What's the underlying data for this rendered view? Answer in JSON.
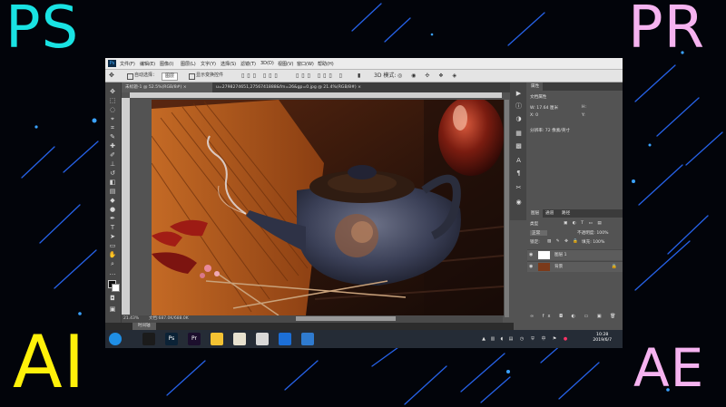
{
  "corner_labels": {
    "ps": "PS",
    "pr": "PR",
    "ai": "AI",
    "ae": "AE"
  },
  "colors": {
    "ps": "#19e3e3",
    "pr": "#f6b3f0",
    "ai": "#fff10a",
    "ae": "#f6b3f0",
    "background": "#02040a",
    "photoshop_ui": "#535353"
  },
  "photoshop": {
    "app_icon": "Ps",
    "menu": [
      "文件(F)",
      "编辑(E)",
      "图像(I)",
      "图层(L)",
      "文字(Y)",
      "选择(S)",
      "滤镜(T)",
      "3D(D)",
      "视图(V)",
      "窗口(W)",
      "帮助(H)"
    ],
    "options_bar": {
      "auto_select": "自动选择：",
      "auto_select_value": "图层",
      "show_transform": "显示变换控件"
    },
    "document_tabs": [
      {
        "label": "未标题-1 @ 52.5%(RGB/8#) ×",
        "active": true
      },
      {
        "label": "u=2798274651,2756741888&fm=26&gp=0.jpg @ 21.4%(RGB/8#) ×",
        "active": false
      }
    ],
    "status": {
      "zoom": "21.43%",
      "doc_size": "文档:687.0K/688.0K"
    },
    "bottom_tab": "时间轴",
    "panels": {
      "properties": {
        "tab": "属性",
        "title": "文档属性",
        "w": "W:  17.64 厘米",
        "h": "H:",
        "x": "X:  0",
        "y": "Y:",
        "resolution": "分辨率: 72 像素/英寸"
      },
      "layers": {
        "tabs": [
          "图层",
          "通道",
          "路径"
        ],
        "kind": "类型",
        "blend_mode": "正常",
        "opacity": "不透明度: 100%",
        "lock": "锁定:",
        "fill": "填充: 100%",
        "items": [
          {
            "name": "图层 1",
            "selected": false,
            "locked": false
          },
          {
            "name": "背景",
            "selected": false,
            "locked": true
          }
        ]
      }
    },
    "taskbar": {
      "apps": [
        {
          "name": "start-orb",
          "color": "#1f8fe6",
          "label": ""
        },
        {
          "name": "app-launcher",
          "color": "#1b1b1b",
          "label": ""
        },
        {
          "name": "photoshop-app",
          "color": "#0b2236",
          "label": "Ps"
        },
        {
          "name": "premiere-app",
          "color": "#1c0f2d",
          "label": "Pr"
        },
        {
          "name": "note-app",
          "color": "#f3c233",
          "label": ""
        },
        {
          "name": "files-app",
          "color": "#e7e1cf",
          "label": ""
        },
        {
          "name": "chrome-app",
          "color": "#d8d8d8",
          "label": ""
        },
        {
          "name": "screen-app",
          "color": "#1c6fd8",
          "label": ""
        },
        {
          "name": "folder-app",
          "color": "#2f7bd0",
          "label": ""
        }
      ],
      "time": "10:28",
      "date": "2019/6/7"
    }
  }
}
